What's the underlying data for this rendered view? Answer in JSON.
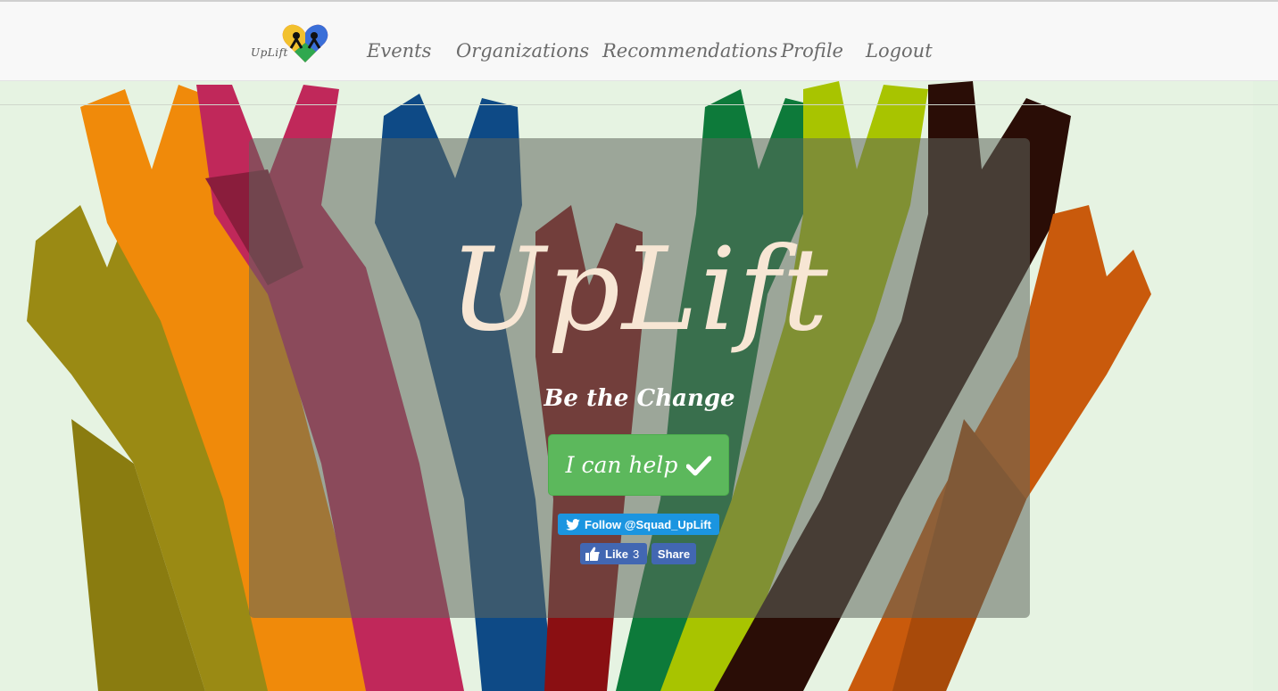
{
  "brand": {
    "logo_text": "UpLift",
    "logo_icon": "heart-puzzle-logo-icon"
  },
  "nav": {
    "items": [
      {
        "label": "Events"
      },
      {
        "label": "Organizations"
      },
      {
        "label": "Recommendations"
      },
      {
        "label": "Profile"
      },
      {
        "label": "Logout"
      }
    ]
  },
  "hero": {
    "title": "UpLift",
    "subtitle": "Be the Change",
    "cta_label": "I can help",
    "cta_icon": "checkmark-icon"
  },
  "social": {
    "twitter_label": "Follow @Squad_UpLift",
    "twitter_icon": "twitter-bird-icon",
    "fb_like_label": "Like",
    "fb_like_count": "3",
    "fb_share_label": "Share",
    "fb_icon": "thumbs-up-icon"
  },
  "colors": {
    "cta": "#5cb85c",
    "twitter": "#1b95e0",
    "facebook": "#4267b2",
    "title": "#f7e6d4"
  }
}
